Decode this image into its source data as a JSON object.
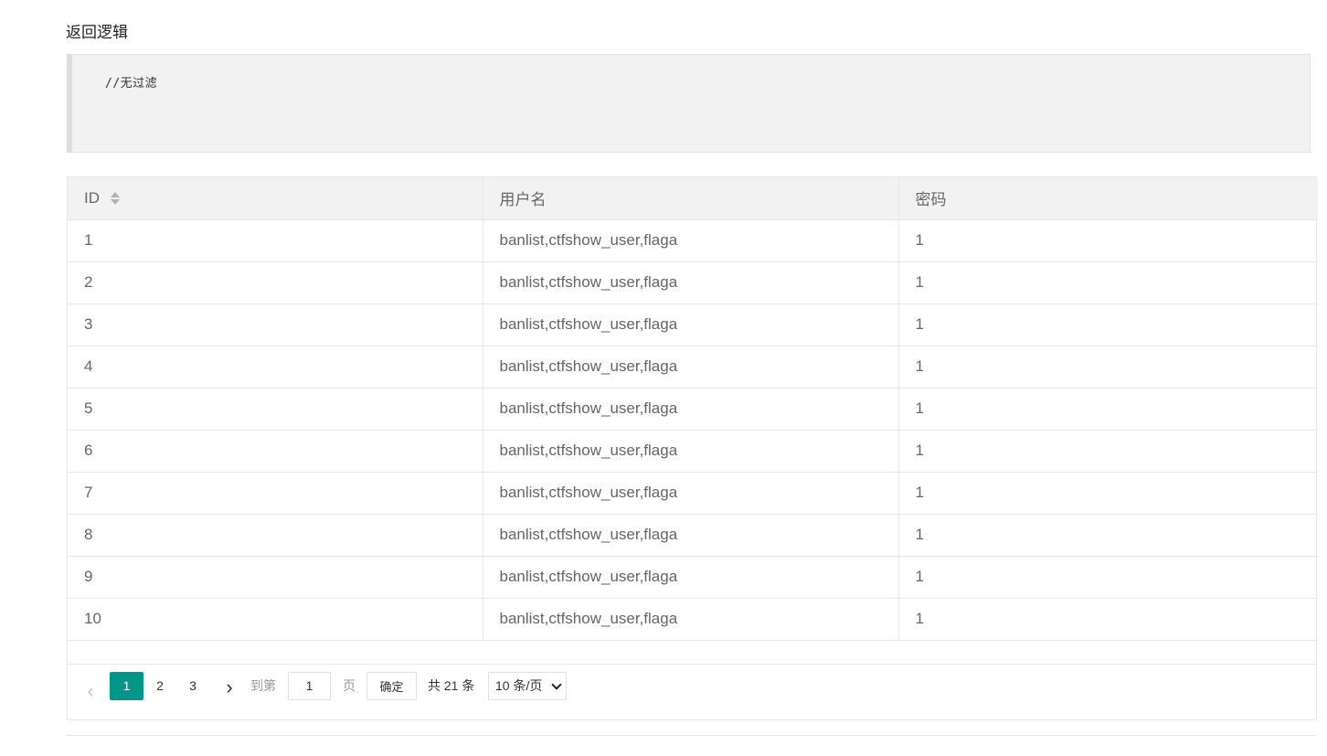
{
  "section_title": "返回逻辑",
  "code_block": {
    "text": "//无过滤"
  },
  "table": {
    "headers": {
      "id": "ID",
      "username": "用户名",
      "password": "密码"
    },
    "rows": [
      {
        "id": "1",
        "username": "banlist,ctfshow_user,flaga",
        "password": "1"
      },
      {
        "id": "2",
        "username": "banlist,ctfshow_user,flaga",
        "password": "1"
      },
      {
        "id": "3",
        "username": "banlist,ctfshow_user,flaga",
        "password": "1"
      },
      {
        "id": "4",
        "username": "banlist,ctfshow_user,flaga",
        "password": "1"
      },
      {
        "id": "5",
        "username": "banlist,ctfshow_user,flaga",
        "password": "1"
      },
      {
        "id": "6",
        "username": "banlist,ctfshow_user,flaga",
        "password": "1"
      },
      {
        "id": "7",
        "username": "banlist,ctfshow_user,flaga",
        "password": "1"
      },
      {
        "id": "8",
        "username": "banlist,ctfshow_user,flaga",
        "password": "1"
      },
      {
        "id": "9",
        "username": "banlist,ctfshow_user,flaga",
        "password": "1"
      },
      {
        "id": "10",
        "username": "banlist,ctfshow_user,flaga",
        "password": "1"
      }
    ]
  },
  "pagination": {
    "prev_icon": "chevron-left-icon",
    "next_icon": "chevron-right-icon",
    "pages": [
      "1",
      "2",
      "3"
    ],
    "current_page": "1",
    "goto_label": "到第",
    "goto_value": "1",
    "page_label": "页",
    "confirm_label": "确定",
    "total_label": "共 21 条",
    "page_size_label": "10 条/页"
  },
  "colors": {
    "accent": "#009688",
    "header_bg": "#f2f2f2",
    "code_bg": "#f2f2f2"
  }
}
